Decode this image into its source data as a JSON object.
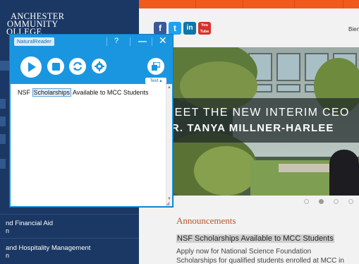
{
  "sidebar": {
    "college_lines": [
      "ANCHESTER",
      "OMMUNITY",
      "OLLEGE"
    ],
    "links": [
      {
        "label": "nd Financial Aid",
        "sub": "n"
      },
      {
        "label": "and Hospitality Management",
        "sub": "n"
      }
    ]
  },
  "header": {
    "social": [
      "f",
      "t",
      "in",
      "You Tube"
    ],
    "right_label": "Bien"
  },
  "hero": {
    "line1": "MEET THE NEW INTERIM CEO",
    "line2": "DR. TANYA MILLNER-HARLEE"
  },
  "announcements": {
    "title": "Announcements",
    "headline": "NSF Scholarships Available to MCC Students",
    "body_lines": [
      "Apply now for National Science Foundation",
      "Scholarships for qualified students enrolled at MCC in"
    ]
  },
  "reader": {
    "brand": "NaturalReader",
    "help": "?",
    "minimize": "—",
    "close": "✕",
    "text_tab": "Text ▴",
    "text_before": "NSF ",
    "text_highlight": "Scholarships",
    "text_after": " Available to MCC Students"
  },
  "icons": {
    "play": "play-icon",
    "stop": "stop-icon",
    "loop": "loop-icon",
    "settings": "gear-icon",
    "window": "restore-window-icon"
  },
  "colors": {
    "sidebar": "#1b3763",
    "reader_blue": "#1a96e1",
    "accent_orange": "#f05a1c",
    "announce_title": "#b4532b"
  }
}
